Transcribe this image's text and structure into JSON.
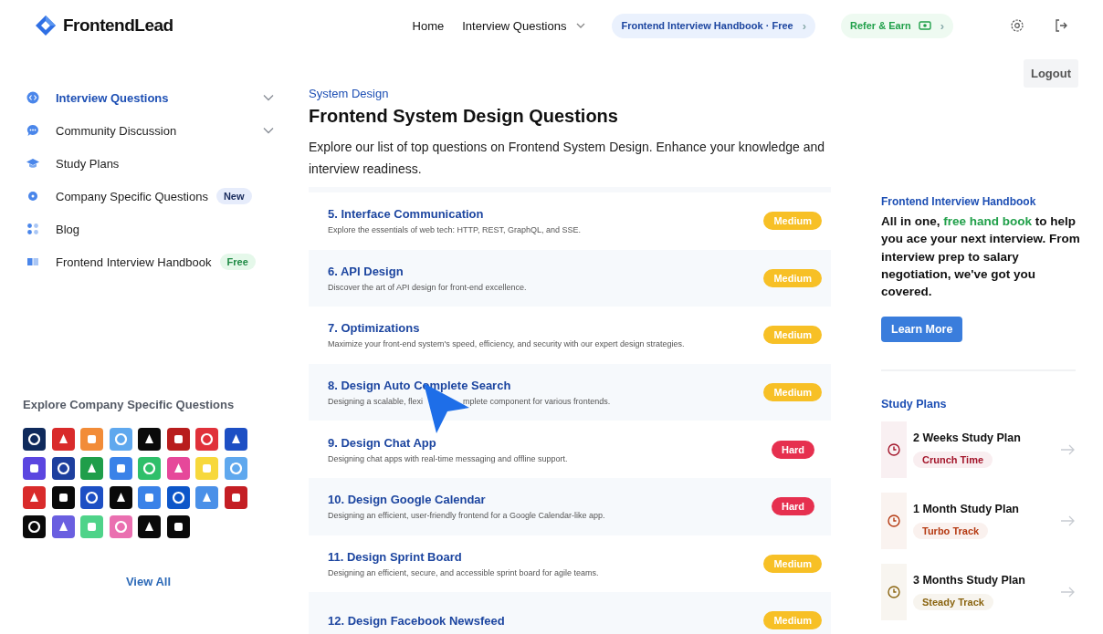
{
  "brand": "FrontendLead",
  "nav": [
    {
      "label": "Home"
    },
    {
      "label": "Interview Questions",
      "dropdown": true
    }
  ],
  "handbook_pill": {
    "label": "Frontend Interview Handbook · **Free**",
    "arrow": "›"
  },
  "refer_pill": {
    "label": "Refer & Earn",
    "arrow": "›"
  },
  "logout_button": "Logout",
  "sidebar": {
    "items": [
      {
        "label": "Interview Questions",
        "selected": true,
        "expandable": true
      },
      {
        "label": "Community Discussion",
        "selected": false,
        "expandable": true
      },
      {
        "label": "Study Plans",
        "selected": false,
        "expandable": false
      },
      {
        "label": "Company Specific Questions",
        "selected": false,
        "expandable": false,
        "badge": "New",
        "kind": "new"
      },
      {
        "label": "Blog",
        "selected": false,
        "expandable": false
      },
      {
        "label": "Frontend Interview Handbook",
        "selected": false,
        "expandable": false,
        "badge": "Free",
        "kind": "free"
      }
    ],
    "companies_title": "Explore Company Specific Questions",
    "companies": [
      {
        "color": "#0f2a5c"
      },
      {
        "color": "#d92b2b"
      },
      {
        "color": "#f28c38"
      },
      {
        "color": "#5fa8ee"
      },
      {
        "color": "#0a0a0a"
      },
      {
        "color": "#b81d1d"
      },
      {
        "color": "#e0313a"
      },
      {
        "color": "#1d4fc4"
      },
      {
        "color": "#5b46e0"
      },
      {
        "color": "#1d3f9e"
      },
      {
        "color": "#1f9e4a"
      },
      {
        "color": "#3a82e8"
      },
      {
        "color": "#2fbf6a"
      },
      {
        "color": "#e6489a"
      },
      {
        "color": "#f7d83c"
      },
      {
        "color": "#5fa8ee"
      },
      {
        "color": "#d92b2b"
      },
      {
        "color": "#0a0a0a"
      },
      {
        "color": "#1d4fc4"
      },
      {
        "color": "#0a0a0a"
      },
      {
        "color": "#3a82e8"
      },
      {
        "color": "#0d56c9"
      },
      {
        "color": "#4a90e8"
      },
      {
        "color": "#c41e24"
      },
      {
        "color": "#0a0a0a"
      },
      {
        "color": "#6a5fe0"
      },
      {
        "color": "#4fd389"
      },
      {
        "color": "#ea6fb0"
      },
      {
        "color": "#0a0a0a"
      },
      {
        "color": "#0a0a0a"
      }
    ],
    "view_all": "View All"
  },
  "main": {
    "breadcrumb": "System Design",
    "title": "Frontend System Design Questions",
    "intro": "Explore our list of top questions on Frontend System Design. Enhance your knowledge and interview readiness.",
    "questions": [
      {
        "title": "5. Interface Communication",
        "description": [
          "Explore the essentials of web tech: HTTP, REST, GraphQL, and SSE."
        ],
        "difficulty": "Medium",
        "kind": "medium"
      },
      {
        "title": "6. API Design",
        "description": [
          "Discover the art of API design for front-end excellence."
        ],
        "difficulty": "Medium",
        "kind": "medium"
      },
      {
        "title": "7. Optimizations",
        "description": [
          "Maximize your front-end system's speed, efficiency, and security with our expert design strategies."
        ],
        "difficulty": "Medium",
        "kind": "medium"
      },
      {
        "title": "8. Design Auto Complete Search",
        "description": [
          "Designing a scalable, flexi",
          "mplete component for various frontends."
        ],
        "difficulty": "Medium",
        "kind": "medium",
        "cursor": true
      },
      {
        "title": "9. Design Chat App",
        "description": [
          "Designing chat apps with real-time messaging and offline support."
        ],
        "difficulty": "Hard",
        "kind": "hard"
      },
      {
        "title": "10. Design Google Calendar",
        "description": [
          "Designing an efficient, user-friendly frontend for a Google Calendar-like app."
        ],
        "difficulty": "Hard",
        "kind": "hard"
      },
      {
        "title": "11. Design Sprint Board",
        "description": [
          "Designing an efficient, secure, and accessible sprint board for agile teams."
        ],
        "difficulty": "Medium",
        "kind": "medium"
      },
      {
        "title": "12. Design Facebook Newsfeed",
        "difficulty": "Medium",
        "kind": "medium"
      }
    ]
  },
  "aside": {
    "handbook_title": "Frontend Interview Handbook",
    "handbook_text": "All in one, **free hand book** to help you ace your next interview. From interview prep to salary negotiation, we've got you covered.",
    "learn_more": "Learn More",
    "study_plans_title": "Study Plans",
    "plans": [
      {
        "title": "2 Weeks Study Plan",
        "tag": "Crunch Time",
        "color": "#a3152a"
      },
      {
        "title": "1 Month Study Plan",
        "tag": "Turbo Track",
        "color": "#b53a12"
      },
      {
        "title": "3 Months Study Plan",
        "tag": "Steady Track",
        "color": "#8a6410"
      }
    ]
  }
}
